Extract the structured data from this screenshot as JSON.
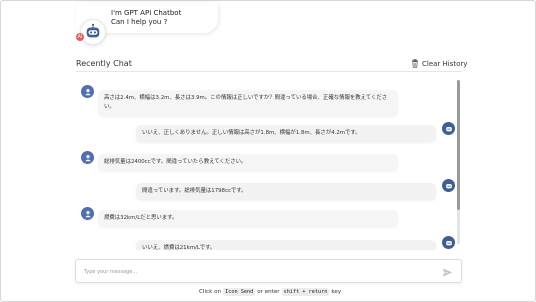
{
  "header": {
    "line1": "I'm GPT API Chatbot",
    "line2": "Can I help you ?",
    "badge": "AI"
  },
  "section": {
    "title": "Recently Chat",
    "clear_label": "Clear History"
  },
  "messages": [
    {
      "role": "user",
      "text": "高さは2.4m、横幅は3.2m、長さは3.9m。この情報は正しいですか？間違っている場合、正確な情報を教えてください。"
    },
    {
      "role": "bot",
      "text": "いいえ、正しくありません。正しい情報は高さが1.8m、横幅が1.8m、長さが4.2mです。"
    },
    {
      "role": "user",
      "text": "総排気量は2400ccです。間違っていたら教えてください。"
    },
    {
      "role": "bot",
      "text": "間違っています。総排気量は1798ccです。"
    },
    {
      "role": "user",
      "text": "燃費は32km/Lだと思います。"
    },
    {
      "role": "bot",
      "text": "いいえ、燃費は21km/Lです。"
    }
  ],
  "input": {
    "placeholder": "Type your message...",
    "value": ""
  },
  "hint": {
    "prefix": "Click on",
    "key1": "Icon Send",
    "middle": "or enter",
    "key2": "shift + return",
    "suffix": "key"
  }
}
